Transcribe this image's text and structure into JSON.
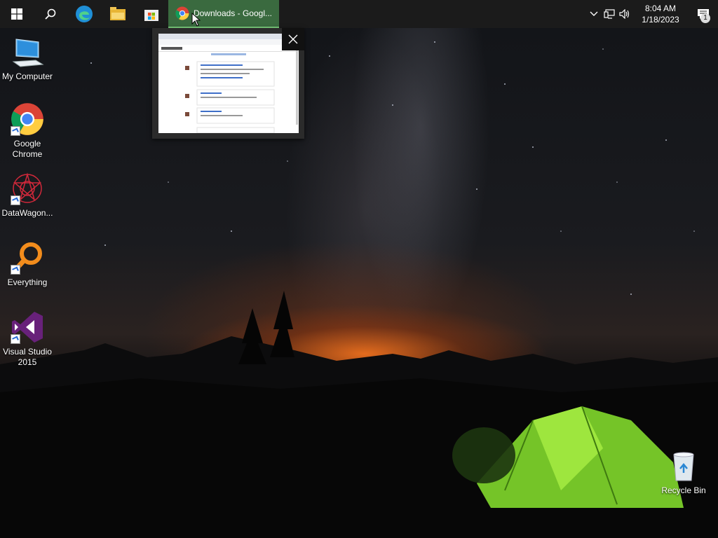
{
  "taskbar": {
    "start_icon": "windows-logo-icon",
    "search_icon": "search-icon",
    "pinned": [
      {
        "name": "edge-icon"
      },
      {
        "name": "file-explorer-icon"
      },
      {
        "name": "microsoft-store-icon"
      }
    ],
    "active_app": {
      "icon": "chrome-icon",
      "title": "Downloads - Googl..."
    },
    "tray": {
      "chevron_icon": "chevron-up-icon",
      "network_icon": "network-icon",
      "volume_icon": "volume-icon",
      "time": "8:04 AM",
      "date": "1/18/2023",
      "notification_icon": "action-center-icon",
      "notification_count": "1"
    },
    "active_color": "#3a6a3f"
  },
  "preview": {
    "title_hint": "Downloads",
    "close_icon": "close-icon"
  },
  "desktop": {
    "icons": [
      {
        "name": "my-computer",
        "label": "My Computer"
      },
      {
        "name": "google-chrome",
        "label": "Google Chrome"
      },
      {
        "name": "datawagon",
        "label": "DataWagon..."
      },
      {
        "name": "everything",
        "label": "Everything"
      },
      {
        "name": "visual-studio-2015",
        "label": "Visual Studio 2015"
      },
      {
        "name": "recycle-bin",
        "label": "Recycle Bin"
      }
    ]
  }
}
